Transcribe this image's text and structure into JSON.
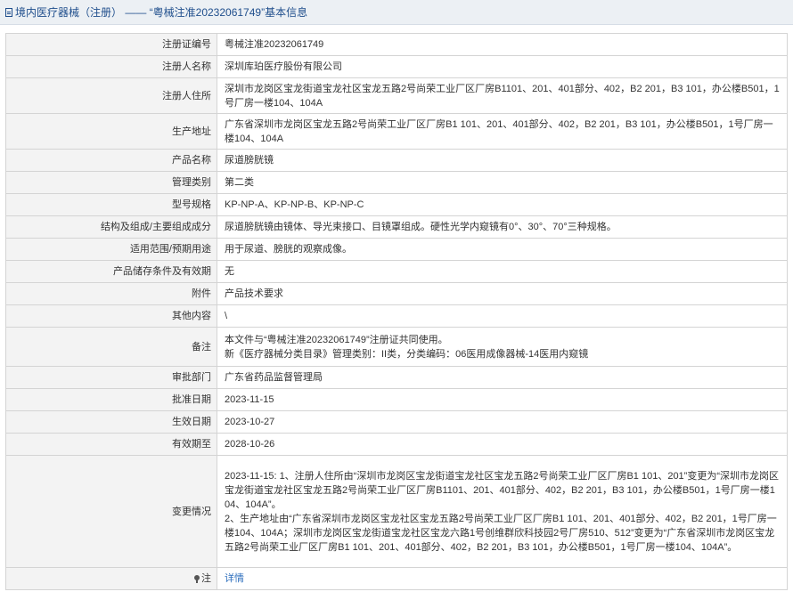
{
  "header": {
    "title": "境内医疗器械（注册） —— “粤械注准20232061749”基本信息"
  },
  "rows": [
    {
      "label": "注册证编号",
      "value": "粤械注准20232061749"
    },
    {
      "label": "注册人名称",
      "value": "深圳库珀医疗股份有限公司"
    },
    {
      "label": "注册人住所",
      "value": "深圳市龙岗区宝龙街道宝龙社区宝龙五路2号尚荣工业厂区厂房B1101、201、401部分、402，B2 201，B3 101，办公楼B501，1号厂房一楼104、104A"
    },
    {
      "label": "生产地址",
      "value": "广东省深圳市龙岗区宝龙五路2号尚荣工业厂区厂房B1 101、201、401部分、402，B2 201，B3 101，办公楼B501，1号厂房一楼104、104A"
    },
    {
      "label": "产品名称",
      "value": "尿道膀胱镜"
    },
    {
      "label": "管理类别",
      "value": "第二类"
    },
    {
      "label": "型号规格",
      "value": "KP-NP-A、KP-NP-B、KP-NP-C"
    },
    {
      "label": "结构及组成/主要组成成分",
      "value": "尿道膀胱镜由镜体、导光束接口、目镜罩组成。硬性光学内窥镜有0°、30°、70°三种规格。"
    },
    {
      "label": "适用范围/预期用途",
      "value": "用于尿道、膀胱的观察成像。"
    },
    {
      "label": "产品储存条件及有效期",
      "value": "无"
    },
    {
      "label": "附件",
      "value": "产品技术要求"
    },
    {
      "label": "其他内容",
      "value": "\\"
    },
    {
      "label": "备注",
      "value_lines": [
        "本文件与“粤械注准20232061749”注册证共同使用。",
        "新《医疗器械分类目录》管理类别：II类，分类编码：06医用成像器械-14医用内窥镜"
      ]
    },
    {
      "label": "审批部门",
      "value": "广东省药品监督管理局"
    },
    {
      "label": "批准日期",
      "value": "2023-11-15"
    },
    {
      "label": "生效日期",
      "value": "2023-10-27"
    },
    {
      "label": "有效期至",
      "value": "2028-10-26"
    },
    {
      "label": "变更情况",
      "value_lines": [
        "2023-11-15: 1、注册人住所由“深圳市龙岗区宝龙街道宝龙社区宝龙五路2号尚荣工业厂区厂房B1 101、201”变更为“深圳市龙岗区宝龙街道宝龙社区宝龙五路2号尚荣工业厂区厂房B1101、201、401部分、402，B2 201，B3 101，办公楼B501，1号厂房一楼104、104A”。",
        "2、生产地址由“广东省深圳市龙岗区宝龙社区宝龙五路2号尚荣工业厂区厂房B1 101、201、401部分、402，B2 201，1号厂房一楼104、104A；深圳市龙岗区宝龙街道宝龙社区宝龙六路1号创维群欣科技园2号厂房510、512”变更为“广东省深圳市龙岗区宝龙五路2号尚荣工业厂区厂房B1 101、201、401部分、402，B2 201，B3 101，办公楼B501，1号厂房一楼104、104A”。"
      ]
    },
    {
      "label": "注",
      "value": "详情",
      "icon": "pin-icon"
    }
  ]
}
